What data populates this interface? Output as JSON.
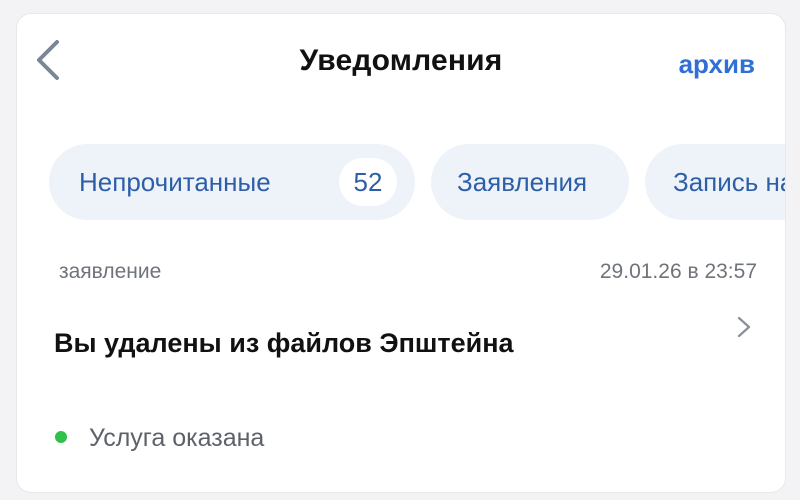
{
  "header": {
    "title": "Уведомления",
    "archive_label": "архив"
  },
  "chips": [
    {
      "label": "Непрочитанные",
      "count": "52"
    },
    {
      "label": "Заявления"
    },
    {
      "label": "Запись на"
    }
  ],
  "notification": {
    "type": "заявление",
    "date": "29.01.26 в 23:57",
    "title": "Вы удалены из файлов Эпштейна",
    "status": "Услуга оказана"
  },
  "colors": {
    "accent": "#2f6fd6",
    "chip_bg": "#eef3fa",
    "status_ok": "#2fc24a"
  },
  "icons": {
    "back": "chevron-left-icon",
    "row": "chevron-right-icon"
  }
}
